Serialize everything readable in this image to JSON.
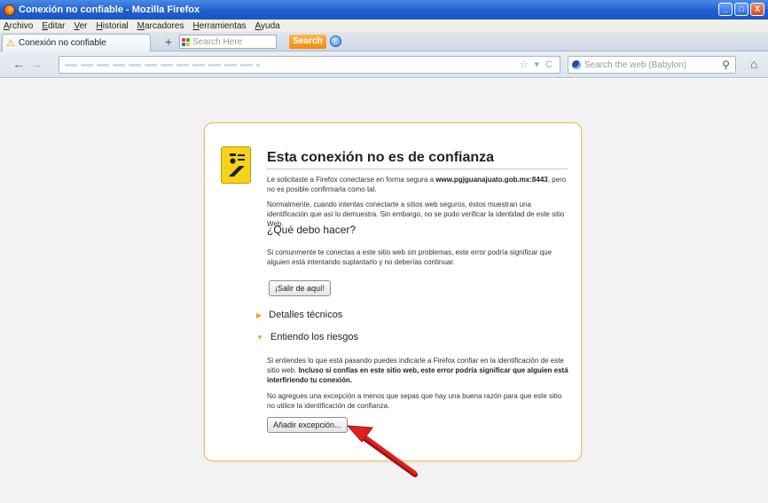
{
  "window": {
    "title": "Conexión no confiable - Mozilla Firefox",
    "buttons": [
      "_",
      "□",
      "X"
    ]
  },
  "menubar": [
    "Archivo",
    "Editar",
    "Ver",
    "Historial",
    "Marcadores",
    "Herramientas",
    "Ayuda"
  ],
  "tabbar": {
    "tab_label": "Conexión no confiable",
    "newtab": "+",
    "search_here_placeholder": "Search Here",
    "search_button": "Search"
  },
  "navbar": {
    "back": "←",
    "forward": "→",
    "url_icons": "☆ ▾ C",
    "web_search_placeholder": "Search the web (Babylon)",
    "search_icon": "magnifier-icon",
    "home_icon": "home-icon"
  },
  "error": {
    "title": "Esta conexión no es de confianza",
    "p1_pre": "Le solicitaste a Firefox conectarse en forma segura a ",
    "p1_host": "www.pgjguanajuato.gob.mx:8443",
    "p1_post": ", pero no es posible confirmarla como tal.",
    "p2": "Normalmente, cuando intentas conectarte a sitios web seguros, éstos muestran una identificación que así lo demuestra. Sin embargo, no se pudo verificar la identidad de este sitio Web.",
    "what_heading": "¿Qué debo hacer?",
    "p3": "Si comunmente te conectas a este sitio web sin problemas, este error podría significar que alguien está intentando suplantarlo y no deberías continuar.",
    "leave_button": "¡Salir de aquí!",
    "tech_details": "Detalles técnicos",
    "understand_risks": "Entiendo los riesgos",
    "p4_pre": "Si entiendes lo que está pasando puedes indicarle a Firefox confiar en la identificación de este sitio web. ",
    "p4_bold": "Incluso si confías en este sitio web, este error podría significar que alguien está interfiriendo tu conexión.",
    "p5": "No agregues una excepción a menos que sepas que hay una buena razón para que este sitio no utilice la identificación de confianza.",
    "add_exception_button": "Añadir excepción..."
  },
  "colors": {
    "title_bar": "#1f5fd0",
    "box_border": "#e6c27a",
    "annotation_arrow": "#e02020"
  }
}
